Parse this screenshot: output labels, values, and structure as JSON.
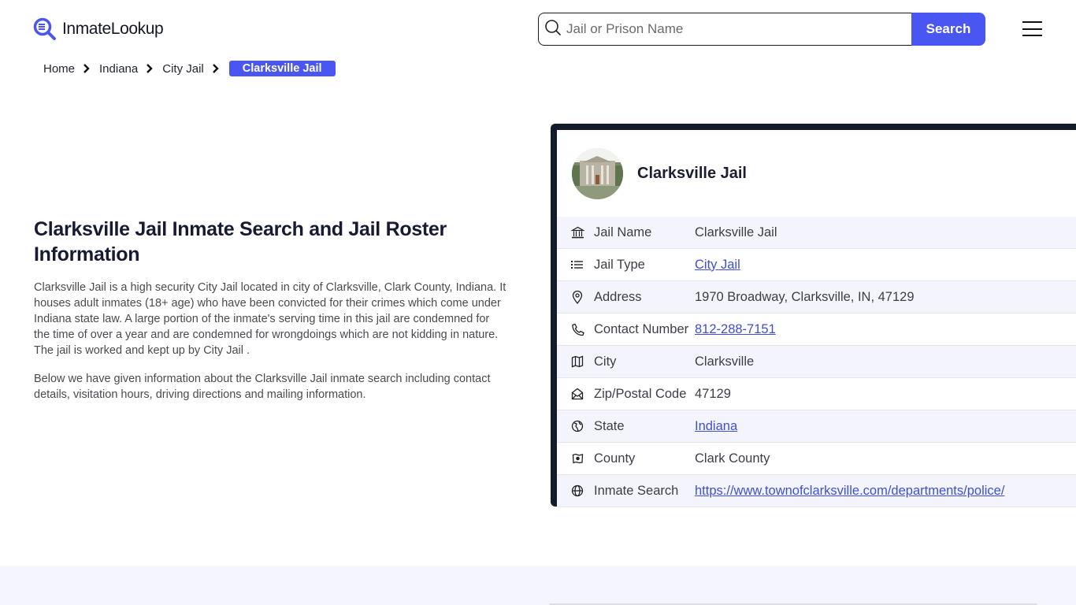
{
  "header": {
    "logo_text": "InmateLookup",
    "search_placeholder": "Jail or Prison Name",
    "search_value": "",
    "search_button": "Search",
    "accent_color": "#4a56f2"
  },
  "breadcrumb": [
    {
      "label": "Home"
    },
    {
      "label": "Indiana"
    },
    {
      "label": "City Jail"
    },
    {
      "label": "Clarksville Jail",
      "active": true
    }
  ],
  "intro": {
    "title": "Clarksville Jail Inmate Search and Jail Roster Information",
    "paragraphs": [
      "Clarksville Jail is a high security City Jail located in city of Clarksville, Clark County, Indiana. It houses adult inmates (18+ age) who have been convicted for their crimes which come under Indiana state law. A large portion of the inmate's serving time in this jail are condemned for the time of over a year and are condemned for wrongdoings which are not kidding in nature. The jail is worked and kept up by City Jail .",
      "Below we have given information about the Clarksville Jail inmate search including contact details, visitation hours, driving directions and mailing information."
    ]
  },
  "card": {
    "title": "Clarksville Jail",
    "rows": [
      {
        "icon": "bank-icon",
        "label": "Jail Name",
        "value": "Clarksville Jail",
        "link": false
      },
      {
        "icon": "list-icon",
        "label": "Jail Type",
        "value": "City Jail",
        "link": true
      },
      {
        "icon": "map-pin-icon",
        "label": "Address",
        "value": "1970 Broadway, Clarksville, IN, 47129",
        "link": false
      },
      {
        "icon": "phone-icon",
        "label": "Contact Number",
        "value": "812-288-7151",
        "link": true
      },
      {
        "icon": "map-icon",
        "label": "City",
        "value": "Clarksville",
        "link": false
      },
      {
        "icon": "mail-open-icon",
        "label": "Zip/Postal Code",
        "value": "47129",
        "link": false
      },
      {
        "icon": "globe-region-icon",
        "label": "State",
        "value": "Indiana",
        "link": true
      },
      {
        "icon": "county-icon",
        "label": "County",
        "value": "Clark County",
        "link": false
      },
      {
        "icon": "globe-icon",
        "label": "Inmate Search",
        "value": "https://www.townofclarksville.com/departments/police/",
        "link": true
      }
    ]
  }
}
